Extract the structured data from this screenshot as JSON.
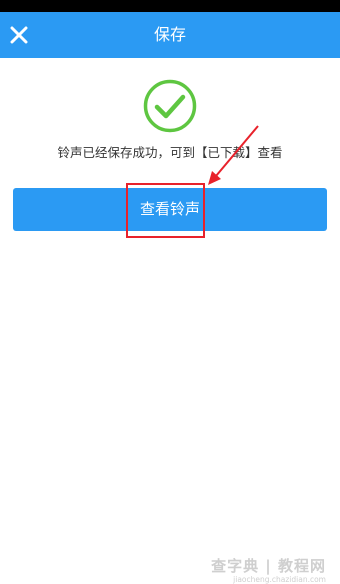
{
  "app_bar": {
    "title": "保存",
    "close_icon": "close-icon",
    "background": "#2b9af3"
  },
  "status": {
    "icon": "check-circle-icon",
    "icon_color": "#5ec641",
    "message": "铃声已经保存成功，可到【已下载】查看"
  },
  "action": {
    "button_label": "查看铃声",
    "button_color": "#2b9af3"
  },
  "annotation": {
    "highlight_color": "#e8222b"
  },
  "watermark": {
    "main": "查字典 | 教程网",
    "url": "jiaocheng.chazidian.com"
  }
}
